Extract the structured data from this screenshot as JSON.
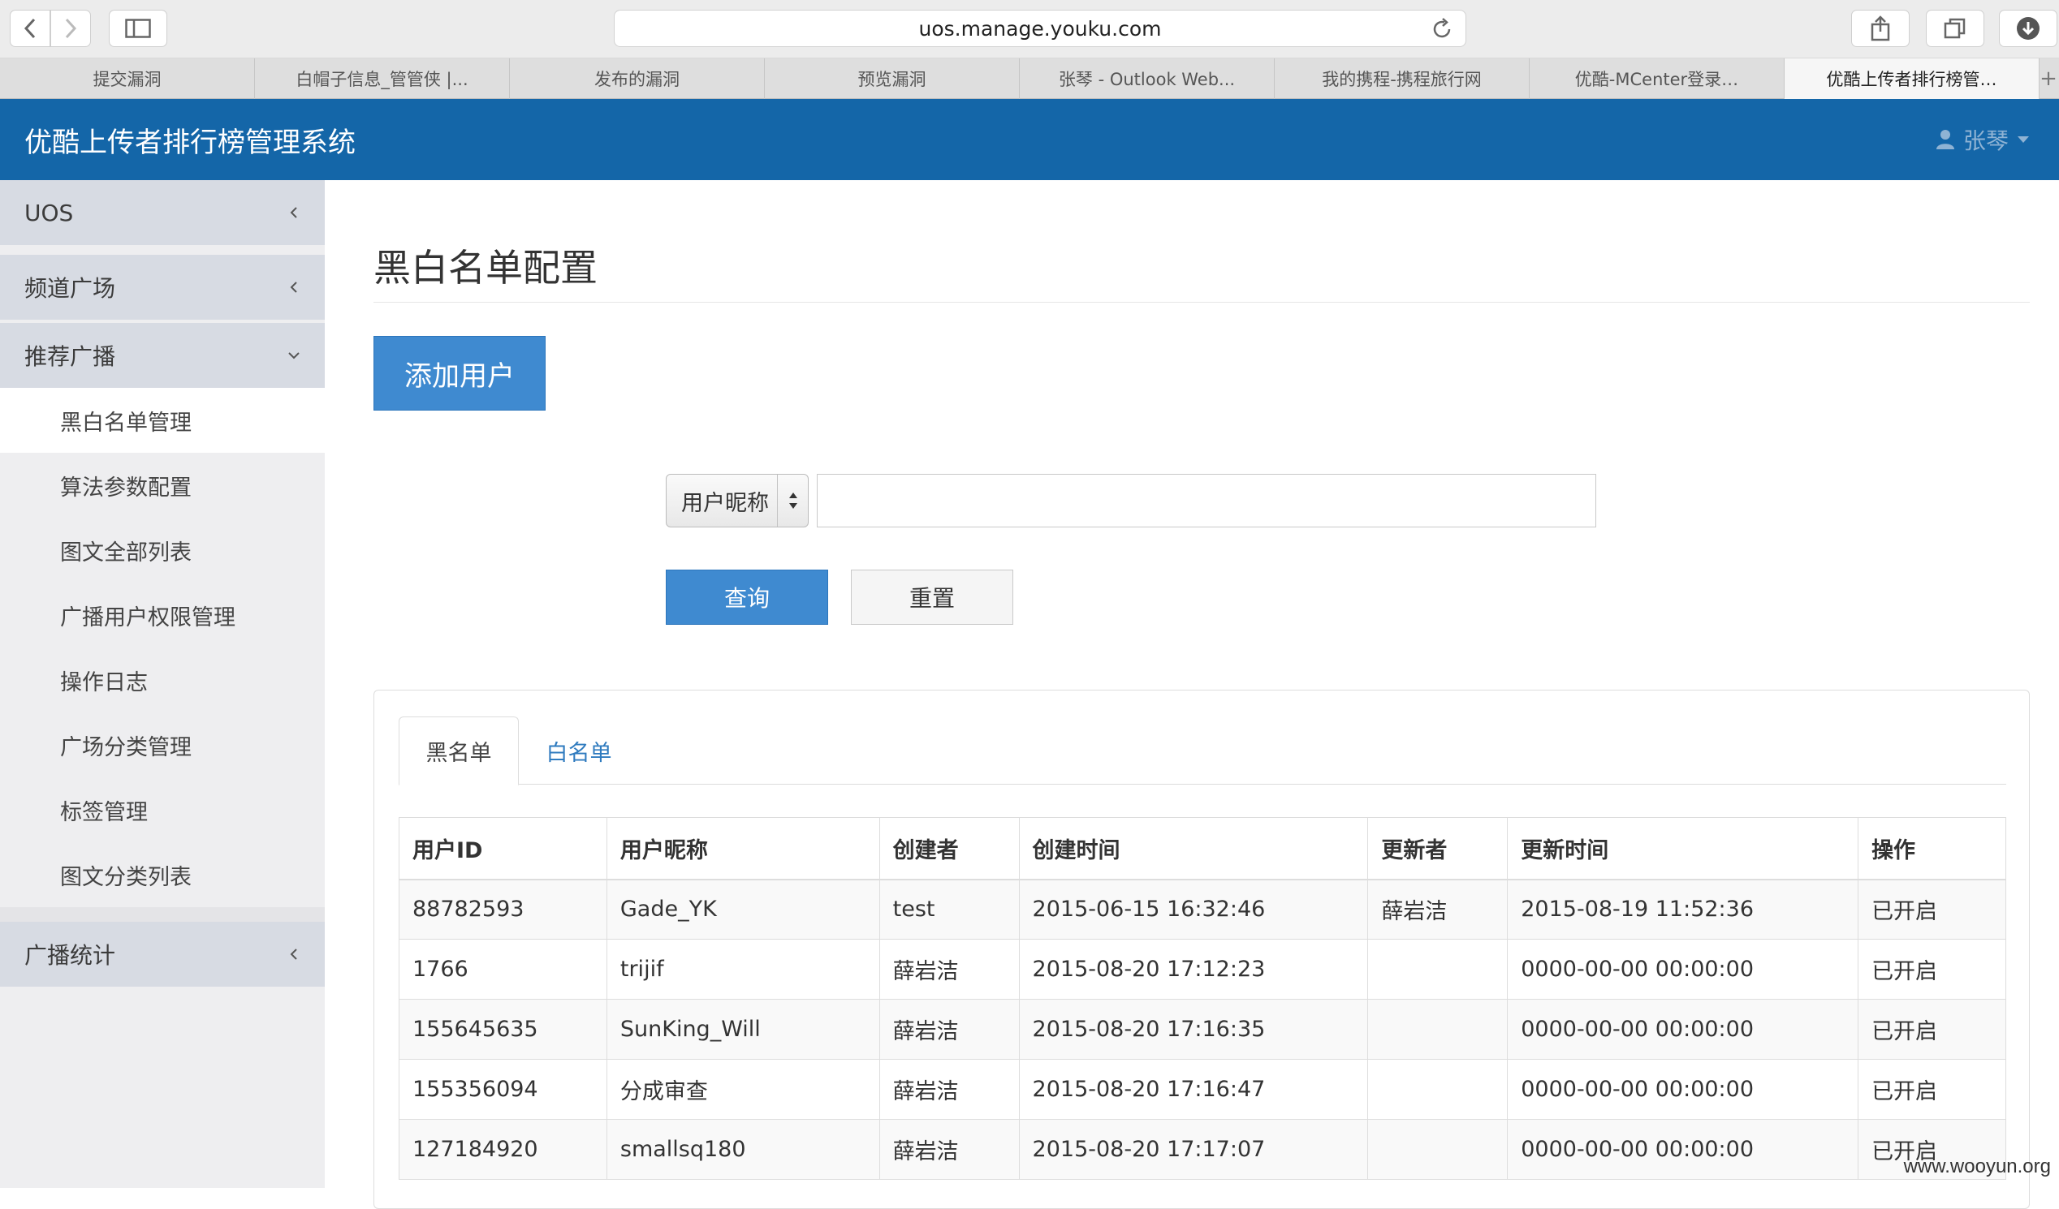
{
  "browser": {
    "url": "uos.manage.youku.com",
    "tabs": [
      {
        "label": "提交漏洞"
      },
      {
        "label": "白帽子信息_管管侠 |..."
      },
      {
        "label": "发布的漏洞"
      },
      {
        "label": "预览漏洞"
      },
      {
        "label": "张琴 - Outlook Web..."
      },
      {
        "label": "我的携程-携程旅行网"
      },
      {
        "label": "优酷-MCenter登录…"
      },
      {
        "label": "优酷上传者排行榜管…"
      }
    ],
    "new_tab_label": "+"
  },
  "header": {
    "brand": "优酷上传者排行榜管理系统",
    "user_name": "张琴"
  },
  "sidebar": {
    "groups": [
      {
        "label": "UOS"
      },
      {
        "label": "频道广场"
      },
      {
        "label": "推荐广播"
      },
      {
        "label": "广播统计"
      }
    ],
    "items": [
      {
        "label": "黑白名单管理"
      },
      {
        "label": "算法参数配置"
      },
      {
        "label": "图文全部列表"
      },
      {
        "label": "广播用户权限管理"
      },
      {
        "label": "操作日志"
      },
      {
        "label": "广场分类管理"
      },
      {
        "label": "标签管理"
      },
      {
        "label": "图文分类列表"
      }
    ]
  },
  "main": {
    "title": "黑白名单配置",
    "add_button": "添加用户",
    "search": {
      "field_selected": "用户昵称",
      "value": "",
      "placeholder": ""
    },
    "query_button": "查询",
    "reset_button": "重置",
    "tabs": [
      {
        "label": "黑名单"
      },
      {
        "label": "白名单"
      }
    ],
    "table": {
      "headers": [
        "用户ID",
        "用户昵称",
        "创建者",
        "创建时间",
        "更新者",
        "更新时间",
        "操作"
      ],
      "rows": [
        {
          "id": "88782593",
          "nickname": "Gade_YK",
          "creator": "test",
          "created": "2015-06-15 16:32:46",
          "updater": "薛岩洁",
          "updated": "2015-08-19 11:52:36",
          "action": "已开启"
        },
        {
          "id": "1766",
          "nickname": "trijif",
          "creator": "薛岩洁",
          "created": "2015-08-20 17:12:23",
          "updater": "",
          "updated": "0000-00-00 00:00:00",
          "action": "已开启"
        },
        {
          "id": "155645635",
          "nickname": "SunKing_Will",
          "creator": "薛岩洁",
          "created": "2015-08-20 17:16:35",
          "updater": "",
          "updated": "0000-00-00 00:00:00",
          "action": "已开启"
        },
        {
          "id": "155356094",
          "nickname": "分成审查",
          "creator": "薛岩洁",
          "created": "2015-08-20 17:16:47",
          "updater": "",
          "updated": "0000-00-00 00:00:00",
          "action": "已开启"
        },
        {
          "id": "127184920",
          "nickname": "smallsq180",
          "creator": "薛岩洁",
          "created": "2015-08-20 17:17:07",
          "updater": "",
          "updated": "0000-00-00 00:00:00",
          "action": "已开启"
        }
      ]
    }
  },
  "watermark": "www.wooyun.org",
  "colors": {
    "header_bg": "#1466a8",
    "primary_button": "#3f8ad0",
    "link": "#2f7bbf",
    "status_red": "#d32a2a",
    "sidebar_group_bg": "#d7dbe3"
  }
}
